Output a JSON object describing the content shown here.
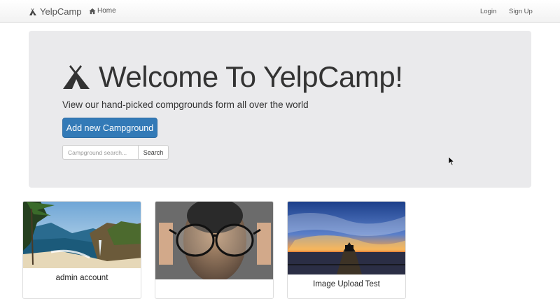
{
  "navbar": {
    "brand_icon": "tent-icon",
    "brand": "YelpCamp",
    "home_icon": "home-icon",
    "home": "Home",
    "login": "Login",
    "signup": "Sign Up"
  },
  "hero": {
    "icon": "tent-icon",
    "title": "Welcome To YelpCamp!",
    "subtitle": "View our hand-picked compgrounds form all over the world",
    "add_button": "Add new Campground",
    "search_placeholder": "Campground search...",
    "search_button": "Search"
  },
  "cards": [
    {
      "title": "admin account"
    },
    {
      "title": ""
    },
    {
      "title": "Image Upload Test"
    }
  ],
  "colors": {
    "primary": "#337ab7",
    "jumbotron": "#eaeaec"
  }
}
